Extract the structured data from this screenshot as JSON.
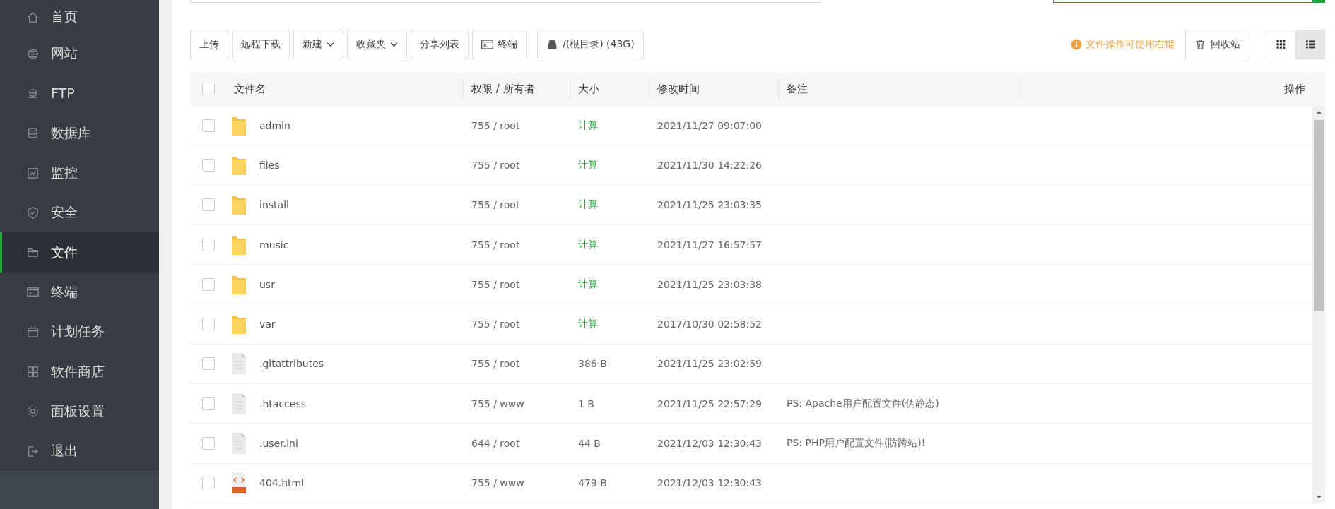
{
  "sidebar": {
    "items": [
      {
        "label": "首页",
        "selected": false
      },
      {
        "label": "网站",
        "selected": false
      },
      {
        "label": "FTP",
        "selected": false
      },
      {
        "label": "数据库",
        "selected": false
      },
      {
        "label": "监控",
        "selected": false
      },
      {
        "label": "安全",
        "selected": false
      },
      {
        "label": "文件",
        "selected": true
      },
      {
        "label": "终端",
        "selected": false
      },
      {
        "label": "计划任务",
        "selected": false
      },
      {
        "label": "软件商店",
        "selected": false
      },
      {
        "label": "面板设置",
        "selected": false
      },
      {
        "label": "退出",
        "selected": false
      }
    ]
  },
  "toolbar": {
    "buttons": [
      {
        "kind": "plain",
        "label": "上传"
      },
      {
        "kind": "plain",
        "label": "远程下载"
      },
      {
        "kind": "dropdown",
        "label": "新建"
      },
      {
        "kind": "dropdown",
        "label": "收藏夹"
      },
      {
        "kind": "plain",
        "label": "分享列表"
      },
      {
        "kind": "terminal",
        "label": "终端"
      },
      {
        "kind": "disk",
        "label": "/(根目录) (43G)"
      }
    ],
    "hint": "文件操作可使用右键",
    "recycle_button": "回收站",
    "view_toggles": [
      {
        "kind": "grid",
        "selected": false
      },
      {
        "kind": "list",
        "selected": true
      }
    ]
  },
  "table": {
    "select_all": {
      "checked": false
    },
    "columns": [
      "文件名",
      "权限 / 所有者",
      "大小",
      "修改时间",
      "备注",
      "操作"
    ],
    "rows": [
      {
        "kind": "folder",
        "checked": false,
        "name": "admin",
        "perms": "755 / root",
        "size": "计算",
        "mtime": "2021/11/27 09:07:00"
      },
      {
        "kind": "folder",
        "checked": false,
        "name": "files",
        "perms": "755 / root",
        "size": "计算",
        "mtime": "2021/11/30 14:22:26"
      },
      {
        "kind": "folder",
        "checked": false,
        "name": "install",
        "perms": "755 / root",
        "size": "计算",
        "mtime": "2021/11/25 23:03:35"
      },
      {
        "kind": "folder",
        "checked": false,
        "name": "music",
        "perms": "755 / root",
        "size": "计算",
        "mtime": "2021/11/27 16:57:57"
      },
      {
        "kind": "folder",
        "checked": false,
        "name": "usr",
        "perms": "755 / root",
        "size": "计算",
        "mtime": "2021/11/25 23:03:38"
      },
      {
        "kind": "folder",
        "checked": false,
        "name": "var",
        "perms": "755 / root",
        "size": "计算",
        "mtime": "2017/10/30 02:58:52"
      },
      {
        "kind": "file",
        "checked": false,
        "name": ".gitattributes",
        "perms": "755 / root",
        "size": "386 B",
        "mtime": "2021/11/25 23:02:59"
      },
      {
        "kind": "file",
        "checked": false,
        "name": ".htaccess",
        "perms": "755 / www",
        "size": "1 B",
        "mtime": "2021/11/25 22:57:29",
        "note": "PS: Apache用户配置文件(伪静态)"
      },
      {
        "kind": "file",
        "checked": false,
        "name": ".user.ini",
        "perms": "644 / root",
        "size": "44 B",
        "mtime": "2021/12/03 12:30:43",
        "note": "PS: PHP用户配置文件(防跨站)!"
      },
      {
        "kind": "html",
        "checked": false,
        "name": "404.html",
        "perms": "755 / www",
        "size": "479 B",
        "mtime": "2021/12/03 12:30:43"
      }
    ]
  }
}
